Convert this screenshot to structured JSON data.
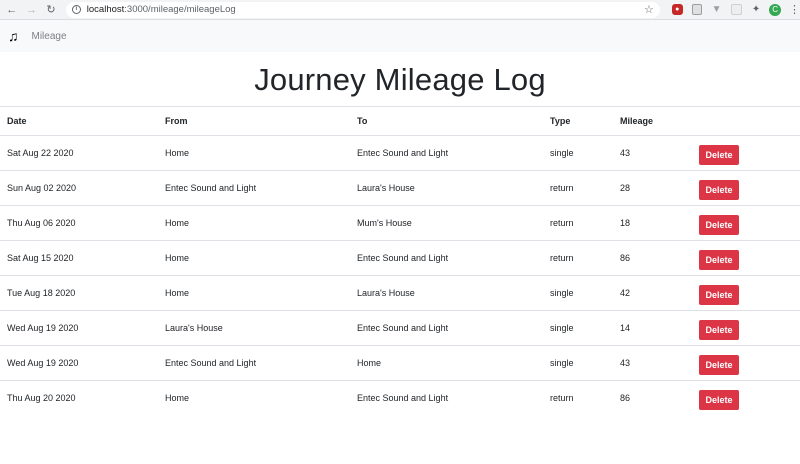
{
  "browser": {
    "url_host": "localhost",
    "url_rest": ":3000/mileage/mileageLog",
    "profile_initial": "C"
  },
  "navbar": {
    "brand_icon": "music-note-icon",
    "link_label": "Mileage"
  },
  "page": {
    "title": "Journey Mileage Log"
  },
  "table": {
    "headers": [
      "Date",
      "From",
      "To",
      "Type",
      "Mileage",
      ""
    ],
    "rows": [
      {
        "date": "Sat Aug 22 2020",
        "from": "Home",
        "to": "Entec Sound and Light",
        "type": "single",
        "mileage": "43",
        "action": "Delete"
      },
      {
        "date": "Sun Aug 02 2020",
        "from": "Entec Sound and Light",
        "to": "Laura's House",
        "type": "return",
        "mileage": "28",
        "action": "Delete"
      },
      {
        "date": "Thu Aug 06 2020",
        "from": "Home",
        "to": "Mum's House",
        "type": "return",
        "mileage": "18",
        "action": "Delete"
      },
      {
        "date": "Sat Aug 15 2020",
        "from": "Home",
        "to": "Entec Sound and Light",
        "type": "return",
        "mileage": "86",
        "action": "Delete"
      },
      {
        "date": "Tue Aug 18 2020",
        "from": "Home",
        "to": "Laura's House",
        "type": "single",
        "mileage": "42",
        "action": "Delete"
      },
      {
        "date": "Wed Aug 19 2020",
        "from": "Laura's House",
        "to": "Entec Sound and Light",
        "type": "single",
        "mileage": "14",
        "action": "Delete"
      },
      {
        "date": "Wed Aug 19 2020",
        "from": "Entec Sound and Light",
        "to": "Home",
        "type": "single",
        "mileage": "43",
        "action": "Delete"
      },
      {
        "date": "Thu Aug 20 2020",
        "from": "Home",
        "to": "Entec Sound and Light",
        "type": "return",
        "mileage": "86",
        "action": "Delete"
      }
    ]
  },
  "colors": {
    "delete_button": "#dc3545",
    "navbar_bg": "#f8f9fa"
  }
}
